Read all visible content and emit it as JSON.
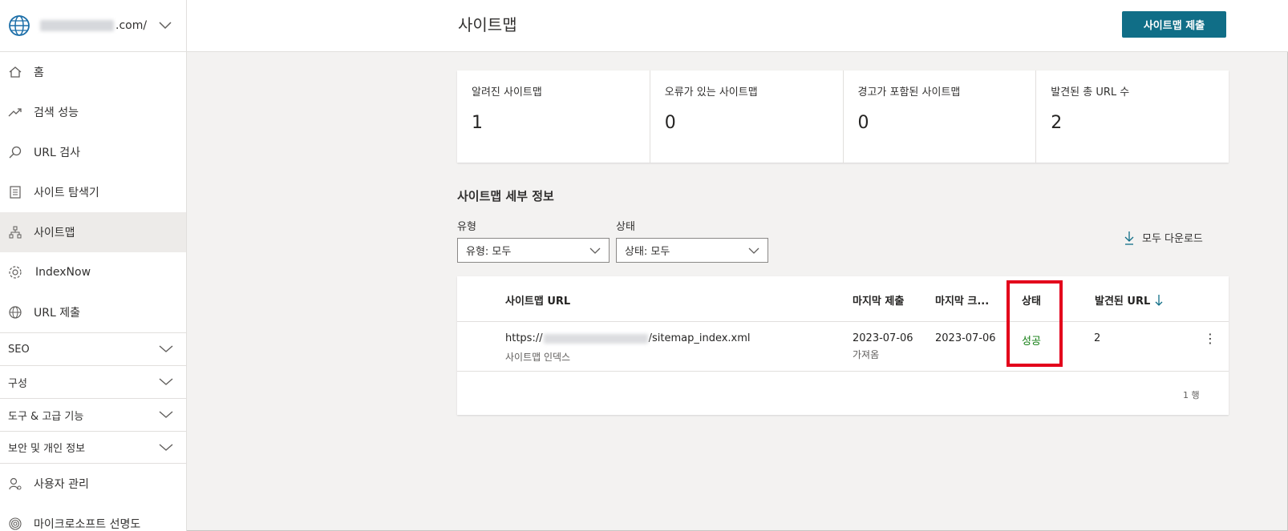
{
  "sidebar": {
    "domain_suffix": ".com/",
    "items": [
      {
        "label": "홈",
        "icon": "home-icon"
      },
      {
        "label": "검색 성능",
        "icon": "trend-icon"
      },
      {
        "label": "URL 검사",
        "icon": "search-icon"
      },
      {
        "label": "사이트 탐색기",
        "icon": "document-icon"
      },
      {
        "label": "사이트맵",
        "icon": "sitemap-icon",
        "active": true
      },
      {
        "label": "IndexNow",
        "icon": "gear-icon"
      },
      {
        "label": "URL 제출",
        "icon": "globe-icon"
      }
    ],
    "groups": [
      "SEO",
      "구성",
      "도구 & 고급 기능",
      "보안 및 개인 정보"
    ],
    "bottom_items": [
      {
        "label": "사용자 관리",
        "icon": "user-icon"
      },
      {
        "label": "마이크로소프트 선명도",
        "icon": "fingerprint-icon"
      }
    ]
  },
  "header": {
    "title": "사이트맵",
    "submit_label": "사이트맵 제출"
  },
  "stats": [
    {
      "label": "알려진 사이트맵",
      "value": "1"
    },
    {
      "label": "오류가 있는 사이트맵",
      "value": "0"
    },
    {
      "label": "경고가 포함된 사이트맵",
      "value": "0"
    },
    {
      "label": "발견된 총 URL 수",
      "value": "2"
    }
  ],
  "details": {
    "title": "사이트맵 세부 정보",
    "type_label": "유형",
    "type_value": "유형: 모두",
    "status_label": "상태",
    "status_value": "상태: 모두",
    "download_label": "모두 다운로드"
  },
  "table": {
    "headers": {
      "url": "사이트맵 URL",
      "last_submitted": "마지막 제출",
      "last_crawled": "마지막 크...",
      "status": "상태",
      "discovered": "발견된 URL"
    },
    "rows": [
      {
        "url_prefix": "https://",
        "url_suffix": "/sitemap_index.xml",
        "type": "사이트맵 인덱스",
        "last_submitted": "2023-07-06",
        "last_submitted_sub": "가져옴",
        "last_crawled": "2023-07-06",
        "status": "성공",
        "discovered": "2"
      }
    ],
    "row_count": "1 행"
  },
  "colors": {
    "accent": "#106e87",
    "success": "#107c10",
    "highlight": "#e3001b"
  }
}
